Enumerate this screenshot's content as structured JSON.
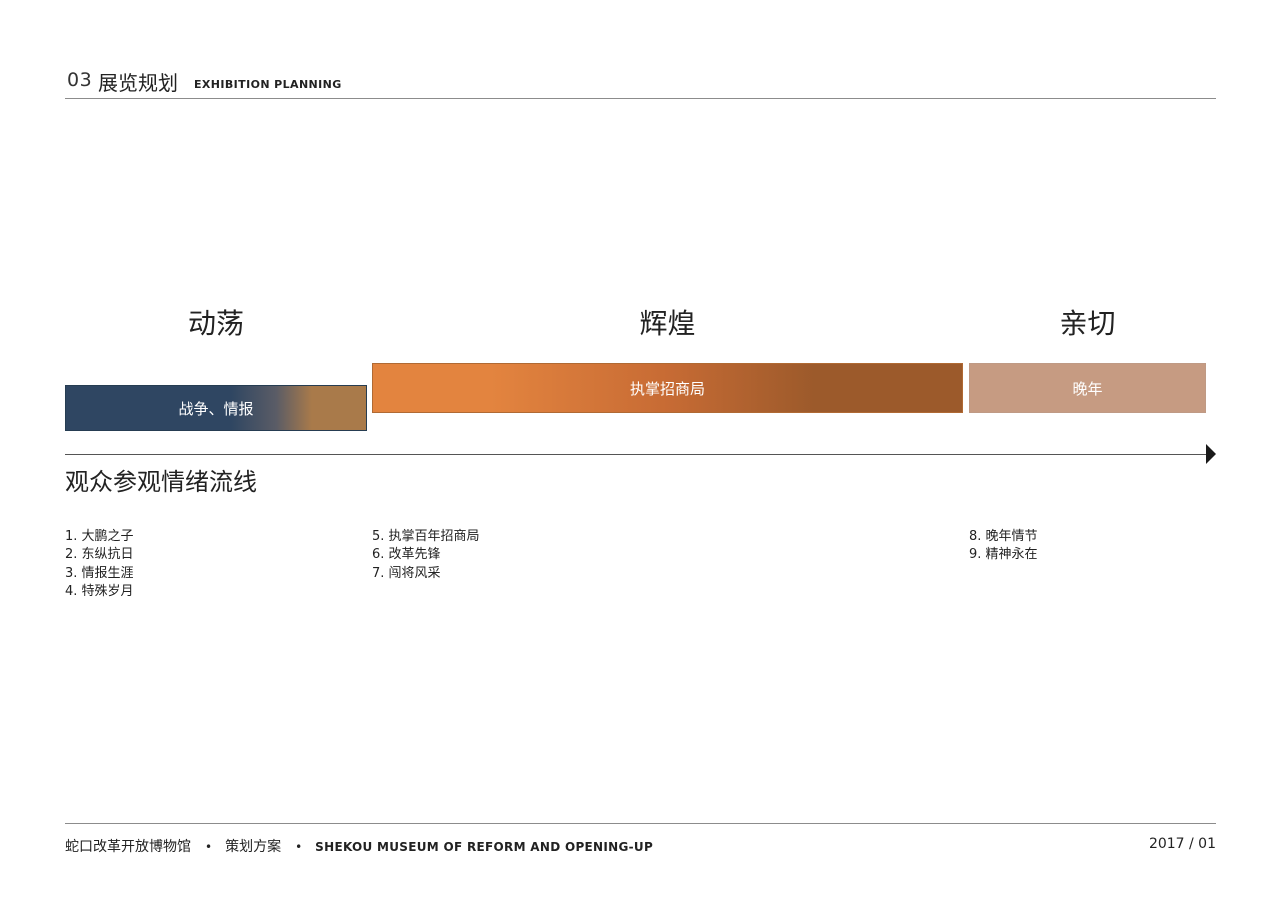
{
  "header": {
    "number": "03",
    "title": "展览规划",
    "subtitle_en": "EXHIBITION PLANNING"
  },
  "phases": [
    {
      "title": "动荡",
      "bar_label": "战争、情报",
      "bar_colors": [
        "#2f4662",
        "#5a5c66",
        "#a97a4a"
      ],
      "items": [
        "1. 大鹏之子",
        "2. 东纵抗日",
        "3. 情报生涯",
        "4. 特殊岁月"
      ]
    },
    {
      "title": "辉煌",
      "bar_label": "执掌招商局",
      "bar_colors": [
        "#e3843f",
        "#c76b34",
        "#9c5a2b"
      ],
      "items": [
        "5. 执掌百年招商局",
        "6. 改革先锋",
        "7. 闯将风采"
      ]
    },
    {
      "title": "亲切",
      "bar_label": "晚年",
      "bar_colors": [
        "#c69b82"
      ],
      "items": [
        "8. 晚年情节",
        "9. 精神永在"
      ]
    }
  ],
  "timeline_label": "观众参观情绪流线",
  "footer": {
    "museum_cn": "蛇口改革开放博物馆",
    "separator": "•",
    "doc_type": "策划方案",
    "museum_en": "SHEKOU MUSEUM OF REFORM AND OPENING-UP",
    "date": "2017 / 01"
  }
}
